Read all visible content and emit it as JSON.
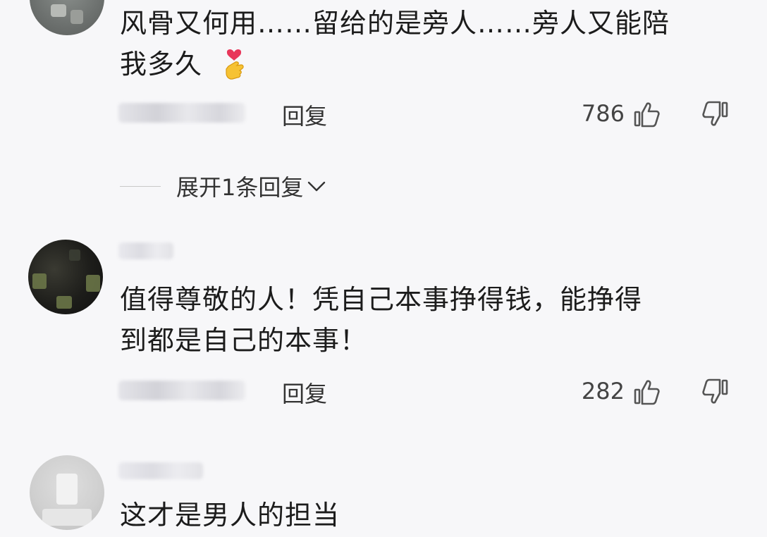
{
  "comments": [
    {
      "text_line1": "风骨又何用……留给的是旁人……旁人又能陪",
      "text_line2": "我多久",
      "emoji": "finger-heart-emoji",
      "reply_label": "回复",
      "likes": "786"
    },
    {
      "text_line1": "值得尊敬的人！凭自己本事挣得钱，能挣得",
      "text_line2": "到都是自己的本事！",
      "reply_label": "回复",
      "likes": "282"
    },
    {
      "text_line1": "这才是男人的担当"
    }
  ],
  "expand_replies": {
    "label": "展开1条回复"
  },
  "icons": {
    "like": "thumbs-up-icon",
    "dislike": "thumbs-down-icon",
    "expand": "chevron-down-icon"
  }
}
